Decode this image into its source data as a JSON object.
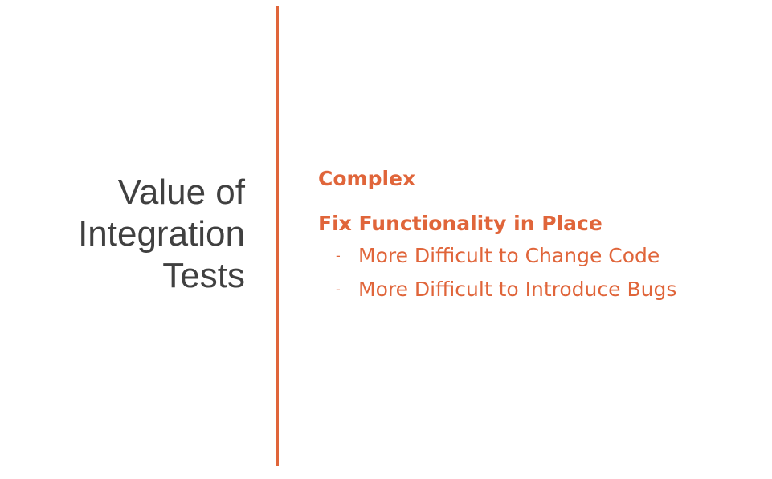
{
  "slide": {
    "title_lines": [
      "Value of",
      "Integration",
      "Tests"
    ],
    "headings": [
      "Complex",
      "Fix Functionality in Place"
    ],
    "bullet_marker": "-",
    "bullets": [
      "More Difficult to Change Code",
      "More Difficult to Introduce Bugs"
    ]
  },
  "colors": {
    "accent": "#e0653a",
    "title_text": "#404040",
    "background": "#ffffff"
  }
}
